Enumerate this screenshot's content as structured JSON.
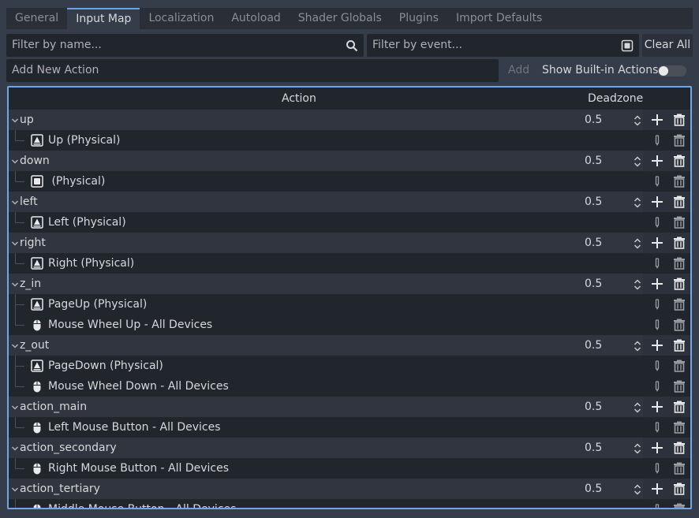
{
  "tabs": [
    {
      "label": "General",
      "active": false
    },
    {
      "label": "Input Map",
      "active": true
    },
    {
      "label": "Localization",
      "active": false
    },
    {
      "label": "Autoload",
      "active": false
    },
    {
      "label": "Shader Globals",
      "active": false
    },
    {
      "label": "Plugins",
      "active": false
    },
    {
      "label": "Import Defaults",
      "active": false
    }
  ],
  "filters": {
    "name_placeholder": "Filter by name...",
    "event_placeholder": "Filter by event...",
    "clear_all": "Clear All"
  },
  "add_action": {
    "placeholder": "Add New Action",
    "add_label": "Add",
    "show_builtin_label": "Show Built-in Actions",
    "show_builtin_on": false
  },
  "tree": {
    "col_action": "Action",
    "col_deadzone": "Deadzone",
    "actions": [
      {
        "name": "up",
        "deadzone": "0.5",
        "events": [
          {
            "icon": "keyboard-icon",
            "label": "Up (Physical)"
          }
        ]
      },
      {
        "name": "down",
        "deadzone": "0.5",
        "events": [
          {
            "icon": "keyboard-icon",
            "label": " (Physical)"
          }
        ]
      },
      {
        "name": "left",
        "deadzone": "0.5",
        "events": [
          {
            "icon": "keyboard-icon",
            "label": "Left (Physical)"
          }
        ]
      },
      {
        "name": "right",
        "deadzone": "0.5",
        "events": [
          {
            "icon": "keyboard-icon",
            "label": "Right (Physical)"
          }
        ]
      },
      {
        "name": "z_in",
        "deadzone": "0.5",
        "events": [
          {
            "icon": "keyboard-icon",
            "label": "PageUp (Physical)"
          },
          {
            "icon": "mouse-icon",
            "label": "Mouse Wheel Up - All Devices"
          }
        ]
      },
      {
        "name": "z_out",
        "deadzone": "0.5",
        "events": [
          {
            "icon": "keyboard-icon",
            "label": "PageDown (Physical)"
          },
          {
            "icon": "mouse-icon",
            "label": "Mouse Wheel Down - All Devices"
          }
        ]
      },
      {
        "name": "action_main",
        "deadzone": "0.5",
        "events": [
          {
            "icon": "mouse-icon",
            "label": "Left Mouse Button - All Devices"
          }
        ]
      },
      {
        "name": "action_secondary",
        "deadzone": "0.5",
        "events": [
          {
            "icon": "mouse-icon",
            "label": "Right Mouse Button - All Devices"
          }
        ]
      },
      {
        "name": "action_tertiary",
        "deadzone": "0.5",
        "events": [
          {
            "icon": "mouse-icon",
            "label": "Middle Mouse Button - All Devices"
          }
        ]
      }
    ]
  }
}
